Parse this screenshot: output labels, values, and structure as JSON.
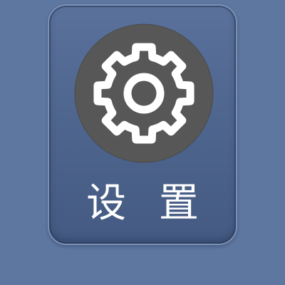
{
  "app_tile": {
    "label": "设 置",
    "icon": "gear-icon",
    "colors": {
      "background": "#5e77a0",
      "tile": "#4f668f",
      "icon_circle": "#575757",
      "icon_stroke": "#ffffff",
      "label": "#ffffff"
    }
  }
}
